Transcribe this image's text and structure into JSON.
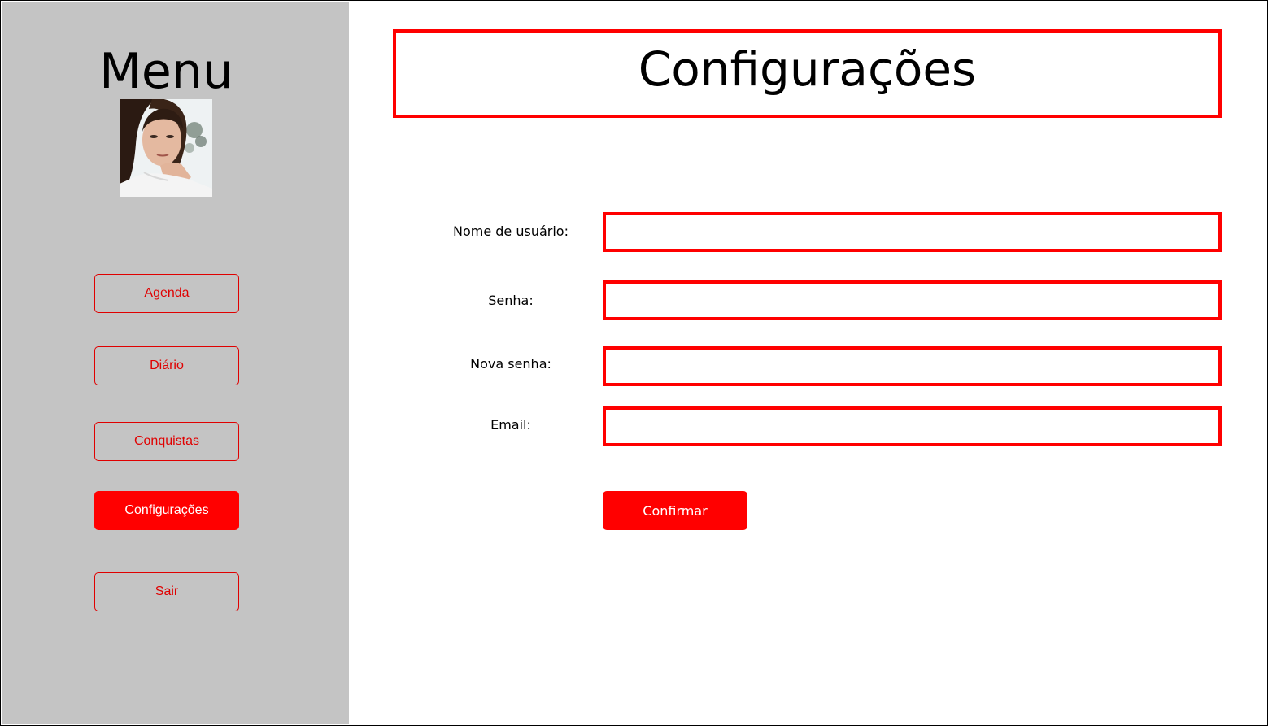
{
  "sidebar": {
    "title": "Menu",
    "avatar": "user-avatar-photo",
    "items": [
      {
        "label": "Agenda",
        "active": false
      },
      {
        "label": "Diário",
        "active": false
      },
      {
        "label": "Conquistas",
        "active": false
      },
      {
        "label": "Configurações",
        "active": true
      },
      {
        "label": "Sair",
        "active": false
      }
    ]
  },
  "main": {
    "title": "Configurações",
    "form": {
      "username_label": "Nome de usuário:",
      "username_value": "",
      "password_label": "Senha:",
      "password_value": "",
      "new_password_label": "Nova senha:",
      "new_password_value": "",
      "email_label": "Email:",
      "email_value": "",
      "confirm_label": "Confirmar"
    }
  },
  "colors": {
    "accent": "#ff0000",
    "sidebar_bg": "#c4c4c4",
    "text": "#000000",
    "background": "#ffffff"
  }
}
